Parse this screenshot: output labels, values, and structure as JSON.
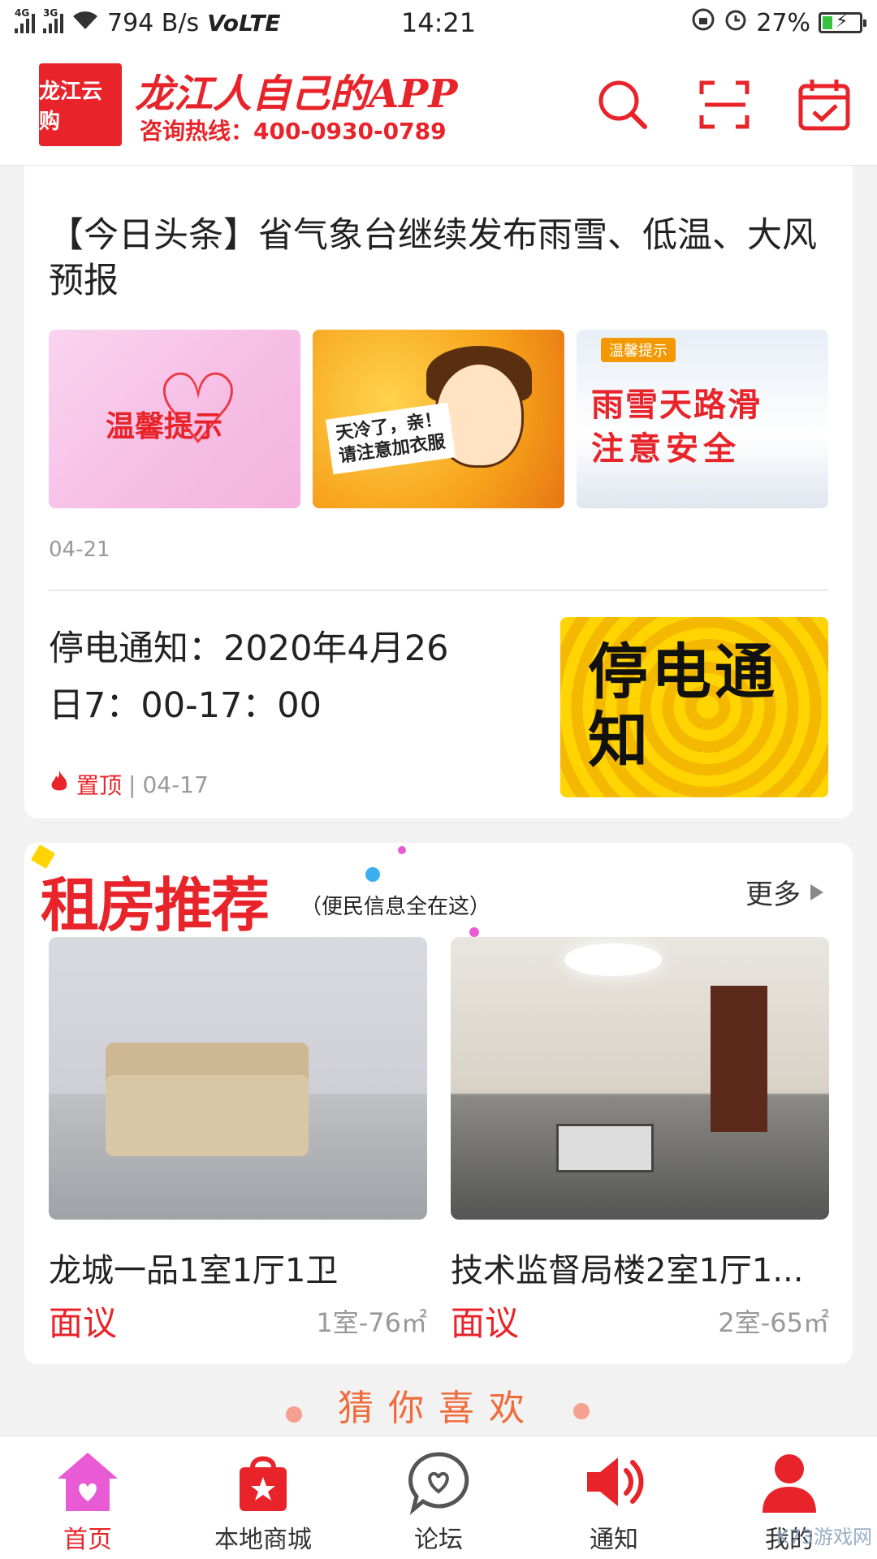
{
  "status_bar": {
    "network_1": "4G",
    "network_2": "3G",
    "speed": "794 B/s",
    "volte": "VoLTE",
    "time": "14:21",
    "battery": "27%",
    "battery_level": 0.27
  },
  "header": {
    "logo_text": "龙江云购",
    "slogan": "龙江人自己的APP",
    "hotline": "咨询热线：400-0930-0789",
    "icons": [
      "search-icon",
      "scan-icon",
      "calendar-check-icon"
    ]
  },
  "news": {
    "headline": "【今日头条】省气象台继续发布雨雪、低温、大风预报",
    "images": {
      "img1_text": "温馨提示",
      "img2_text_1": "天冷了，亲！",
      "img2_text_2": "请注意加衣服",
      "img3_badge": "温馨提示",
      "img3_line1": "雨雪天路滑",
      "img3_line2": "注意安全"
    },
    "headline_date": "04-21",
    "notice_title": "停电通知：2020年4月26日7：00-17：00",
    "notice_pin": "置顶",
    "notice_sep": "|",
    "notice_date": "04-17",
    "notice_img_text": "停电通知"
  },
  "rent": {
    "title": "租房推荐",
    "subtitle": "（便民信息全在这）",
    "more": "更多",
    "houses": [
      {
        "name": "龙城一品1室1厅1卫",
        "price": "面议",
        "spec": "1室-76㎡"
      },
      {
        "name": "技术监督局楼2室1厅1...",
        "price": "面议",
        "spec": "2室-65㎡"
      }
    ]
  },
  "guess": {
    "title": "猜你喜欢"
  },
  "bottom_nav": {
    "items": [
      {
        "label": "首页",
        "icon": "home-icon",
        "active": true
      },
      {
        "label": "本地商城",
        "icon": "shopping-bag-icon",
        "active": false
      },
      {
        "label": "论坛",
        "icon": "chat-heart-icon",
        "active": false
      },
      {
        "label": "通知",
        "icon": "speaker-icon",
        "active": false
      },
      {
        "label": "我的",
        "icon": "user-icon",
        "active": false
      }
    ]
  },
  "watermark": "K73游戏网",
  "colors": {
    "brand_red": "#e8242a",
    "active_pink": "#e85bd5"
  }
}
